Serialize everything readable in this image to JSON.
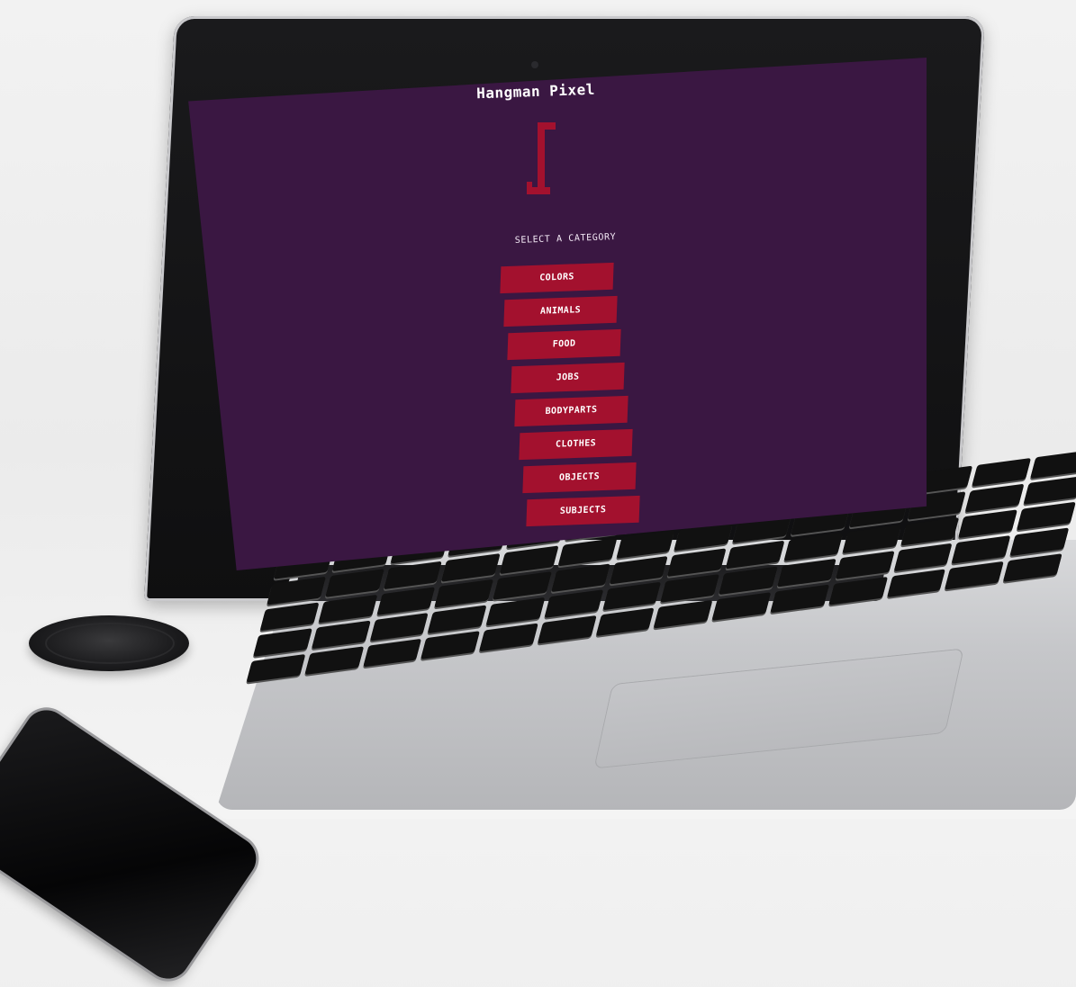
{
  "colors": {
    "background": "#3a1742",
    "accent": "#a3112e",
    "text": "#ffffff"
  },
  "app": {
    "title": "Hangman Pixel"
  },
  "category_select": {
    "prompt": "SELECT A CATEGORY",
    "categories": [
      "COLORS",
      "ANIMALS",
      "FOOD",
      "JOBS",
      "BODYPARTS",
      "CLOTHES",
      "OBJECTS",
      "SUBJECTS"
    ]
  },
  "icons": {
    "gallows": "gallows-icon"
  }
}
